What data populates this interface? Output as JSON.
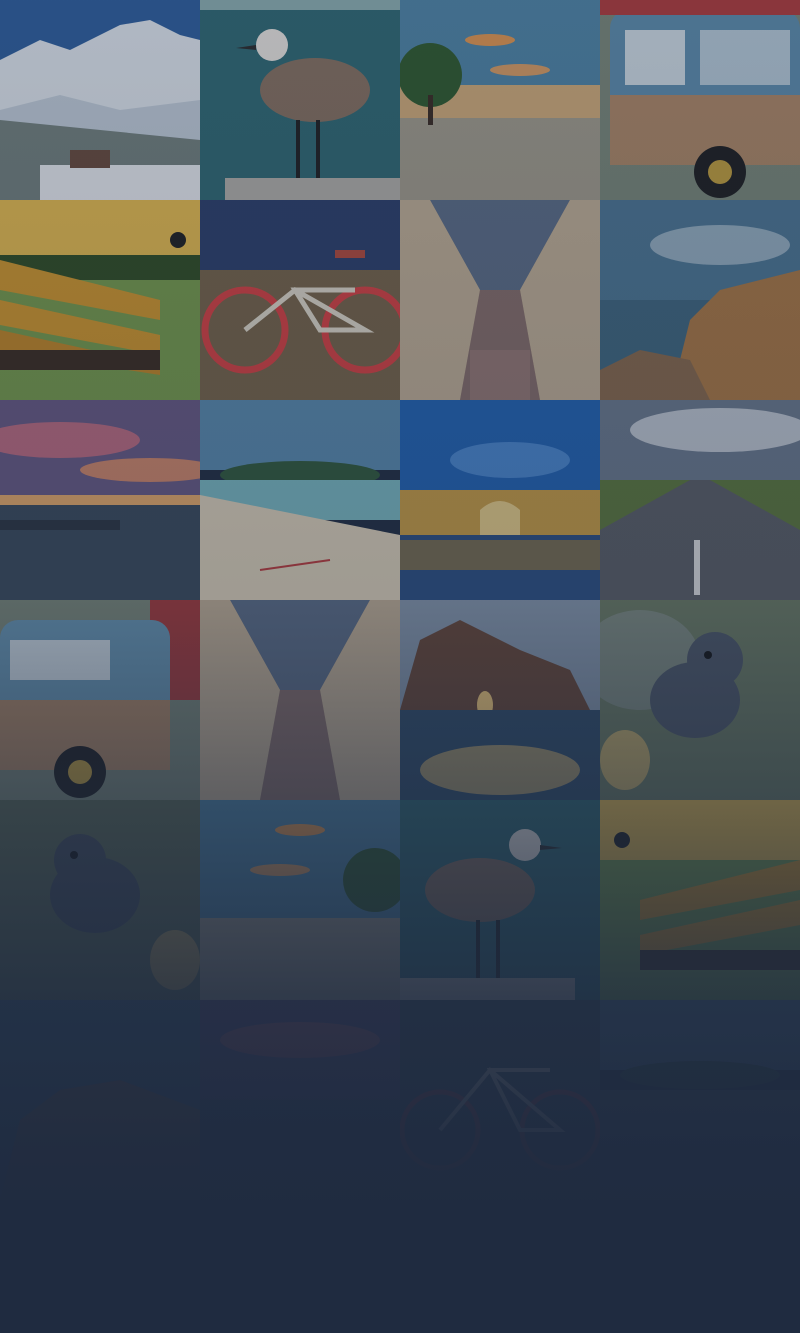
{
  "page": {
    "background": "#1f2b40"
  },
  "gallery": {
    "tiles": [
      {
        "subject": "snowy-mountain-village"
      },
      {
        "subject": "seagull-on-post"
      },
      {
        "subject": "beach-at-dusk"
      },
      {
        "subject": "vintage-van"
      },
      {
        "subject": "park-bench-cyclist"
      },
      {
        "subject": "red-rim-bicycle"
      },
      {
        "subject": "shopping-arcade"
      },
      {
        "subject": "rocky-coast"
      },
      {
        "subject": "sunset-clouds-sea"
      },
      {
        "subject": "sandy-beach-island"
      },
      {
        "subject": "illuminated-palace"
      },
      {
        "subject": "open-road"
      },
      {
        "subject": "vintage-van"
      },
      {
        "subject": "shopping-arcade"
      },
      {
        "subject": "rock-arch-sunset"
      },
      {
        "subject": "small-bird"
      },
      {
        "subject": "small-bird"
      },
      {
        "subject": "beach-at-dusk"
      },
      {
        "subject": "seagull-on-post"
      },
      {
        "subject": "park-bench-cyclist"
      },
      {
        "subject": "rocky-coast"
      },
      {
        "subject": "sunset-clouds-sea"
      },
      {
        "subject": "red-rim-bicycle"
      },
      {
        "subject": "sandy-beach-island"
      }
    ]
  }
}
